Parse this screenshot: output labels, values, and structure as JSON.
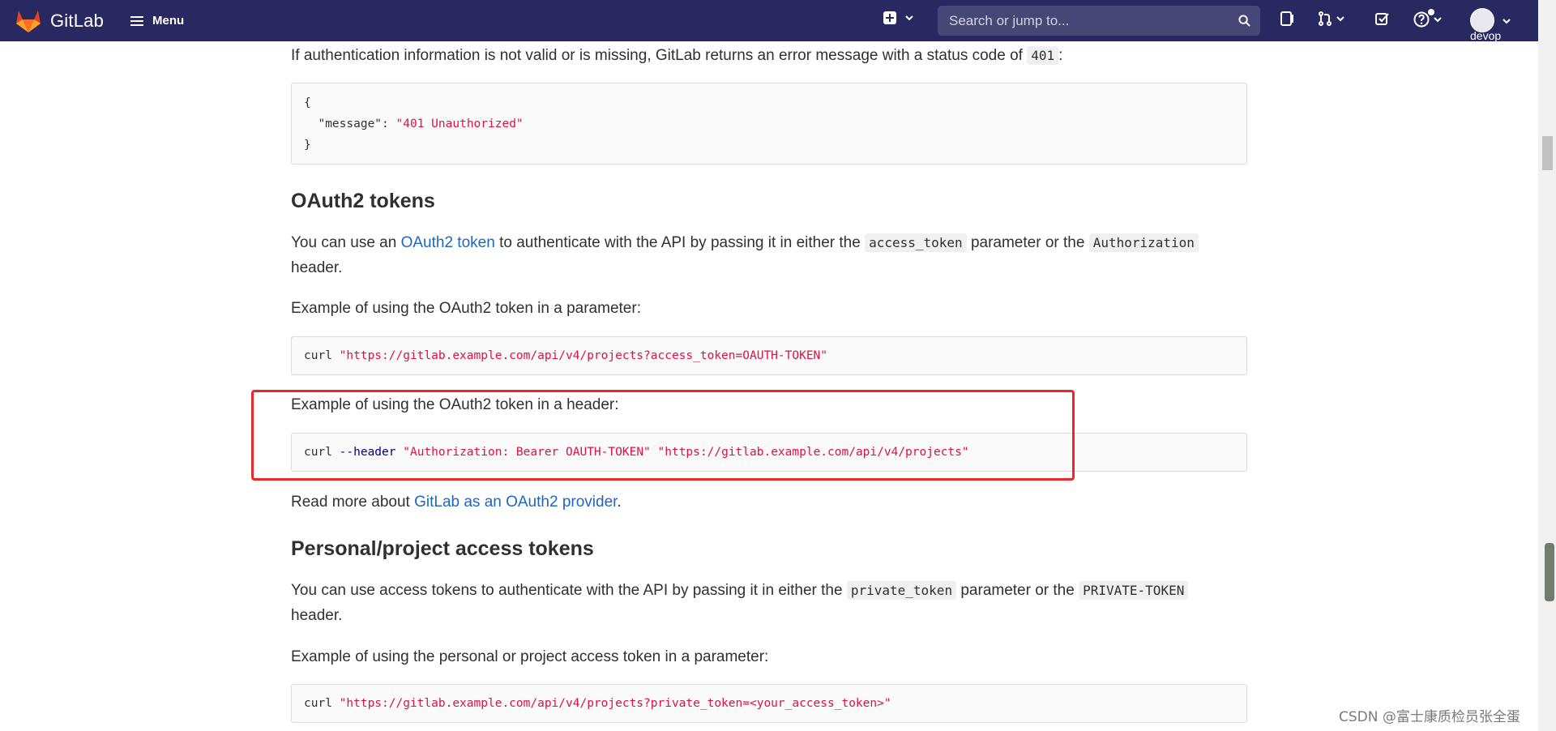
{
  "navbar": {
    "brand_name": "GitLab",
    "menu_label": "Menu",
    "search_placeholder": "Search or jump to...",
    "user_name": "devop",
    "bg_color": "#292961"
  },
  "content": {
    "intro_text": "If authentication information is not valid or is missing, GitLab returns an error message with a status code of",
    "intro_code": "401",
    "intro_suffix": ":",
    "error_block": {
      "line1": "{",
      "key": "\"message\"",
      "colon": ": ",
      "value": "\"401 Unauthorized\"",
      "line3": "}"
    },
    "oauth_heading": "OAuth2 tokens",
    "oauth_p1_a": "You can use an ",
    "oauth_p1_link": "OAuth2 token",
    "oauth_p1_b": " to authenticate with the API by passing it in either the ",
    "oauth_p1_code1": "access_token",
    "oauth_p1_c": " parameter or the ",
    "oauth_p1_code2": "Authorization",
    "oauth_p1_d": "header.",
    "oauth_param_label": "Example of using the OAuth2 token in a parameter:",
    "oauth_param_cmd": "curl",
    "oauth_param_url": "\"https://gitlab.example.com/api/v4/projects?access_token=OAUTH-TOKEN\"",
    "oauth_header_label": "Example of using the OAuth2 token in a header:",
    "oauth_header_cmd": "curl",
    "oauth_header_flag": "--header",
    "oauth_header_value": "\"Authorization: Bearer OAUTH-TOKEN\"",
    "oauth_header_url": "\"https://gitlab.example.com/api/v4/projects\"",
    "read_more_a": "Read more about ",
    "read_more_link": "GitLab as an OAuth2 provider",
    "read_more_b": ".",
    "pat_heading": "Personal/project access tokens",
    "pat_p1_a": "You can use access tokens to authenticate with the API by passing it in either the ",
    "pat_p1_code1": "private_token",
    "pat_p1_b": " parameter or the ",
    "pat_p1_code2": "PRIVATE-TOKEN",
    "pat_p1_c": "header.",
    "pat_param_label": "Example of using the personal or project access token in a parameter:",
    "pat_param_cmd": "curl",
    "pat_param_url": "\"https://gitlab.example.com/api/v4/projects?private_token=<your_access_token>\""
  },
  "watermark": "CSDN @富士康质检员张全蛋",
  "colors": {
    "link": "#1f65c2",
    "string": "#dd1144",
    "keyword": "#000080",
    "highlight_border": "#e8282b"
  },
  "icons": [
    "gitlab-logo-icon",
    "hamburger-icon",
    "plus-square-icon",
    "chevron-down-icon",
    "search-icon",
    "issues-icon",
    "merge-request-icon",
    "todo-icon",
    "help-icon",
    "avatar"
  ]
}
